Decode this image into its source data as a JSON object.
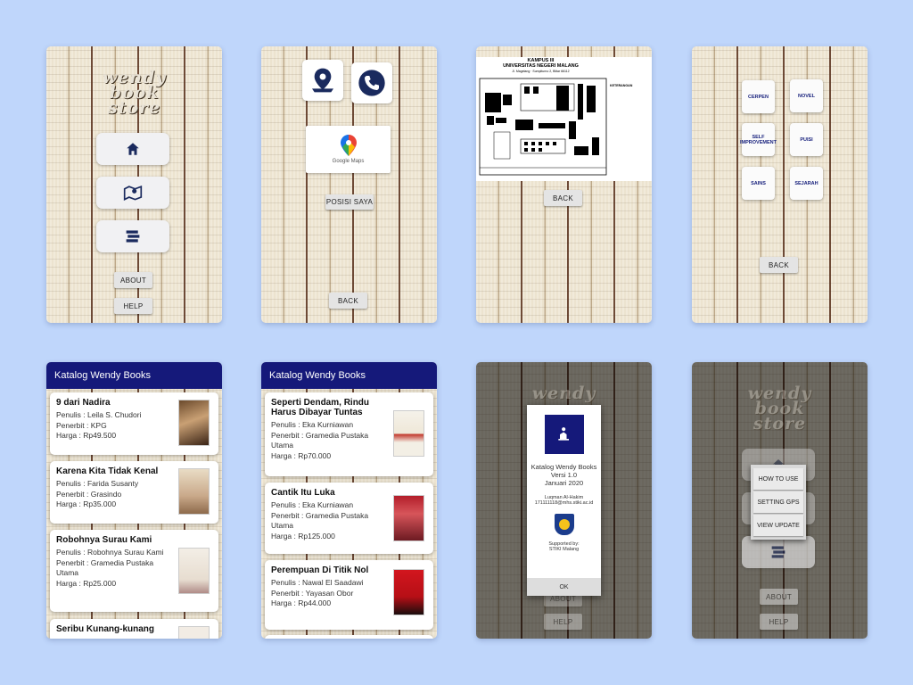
{
  "colors": {
    "page_bg": "#bfd6fb",
    "navy": "#15197a",
    "tile_icon": "#1a2a5e"
  },
  "screen1": {
    "logo": [
      "wendy",
      "book",
      "store"
    ],
    "icons": [
      "home-icon",
      "map-icon",
      "book-stack-icon"
    ],
    "about_label": "ABOUT",
    "help_label": "HELP"
  },
  "screen2": {
    "icons": [
      "location-pin-icon",
      "phone-icon",
      "google-maps-icon"
    ],
    "maps_label": "Google Maps",
    "position_label": "POSISI SAYA",
    "back_label": "BACK"
  },
  "screen3": {
    "map_title_1": "KAMPUS III",
    "map_title_2": "UNIVERSITAS NEGERI MALANG",
    "map_address": "Jl. Magelang · Sumpiturno 2, Blitar 66112",
    "legend_title": "KETERANGAN",
    "back_label": "BACK"
  },
  "screen4": {
    "categories": [
      "CERPEN",
      "NOVEL",
      "SELF IMPROVEMENT",
      "PUISI",
      "SAINS",
      "SEJARAH"
    ],
    "back_label": "BACK"
  },
  "catalog1": {
    "title": "Katalog Wendy Books",
    "books": [
      {
        "title": "9 dari Nadira",
        "penulis": "Penulis   : Leila S. Chudori",
        "penerbit": "Penerbit : KPG",
        "harga": "Harga    : Rp49.500"
      },
      {
        "title": "Karena Kita Tidak Kenal",
        "penulis": "Penulis   : Farida Susanty",
        "penerbit": "Penerbit : Grasindo",
        "harga": "Harga    : Rp35.000"
      },
      {
        "title": "Robohnya Surau Kami",
        "penulis": "Penulis   : Robohnya Surau Kami",
        "penerbit": "Penerbit : Gramedia Pustaka Utama",
        "harga": "Harga    : Rp25.000"
      },
      {
        "title": "Seribu Kunang-kunang",
        "penulis": "",
        "penerbit": "",
        "harga": ""
      }
    ]
  },
  "catalog2": {
    "title": "Katalog Wendy Books",
    "books": [
      {
        "title": "Seperti Dendam, Rindu Harus Dibayar Tuntas",
        "penulis": "Penulis   : Eka Kurniawan",
        "penerbit": "Penerbit : Gramedia Pustaka Utama",
        "harga": "Harga    : Rp70.000"
      },
      {
        "title": "Cantik Itu Luka",
        "penulis": "Penulis   : Eka Kurniawan",
        "penerbit": "Penerbit : Gramedia Pustaka Utama",
        "harga": "Harga    : Rp125.000"
      },
      {
        "title": "Perempuan Di Titik Nol",
        "penulis": "Penulis   : Nawal El Saadawi",
        "penerbit": "Penerbit : Yayasan Obor",
        "harga": "Harga    : Rp44.000"
      }
    ]
  },
  "about_dialog": {
    "app_name": "Katalog Wendy Books",
    "version": "Versi 1.0",
    "date": "Januari 2020",
    "author": "Luqman Al-Hakim",
    "email": "171111118@mhs.stiki.ac.id",
    "supported_label": "Supported by:",
    "supporter": "STIKI Malang",
    "ok_label": "OK",
    "about_label": "ABOUT",
    "help_label": "HELP"
  },
  "help_menu": {
    "items": [
      "HOW TO USE",
      "SETTING GPS",
      "VIEW UPDATE"
    ],
    "about_label": "ABOUT",
    "help_label": "HELP"
  }
}
